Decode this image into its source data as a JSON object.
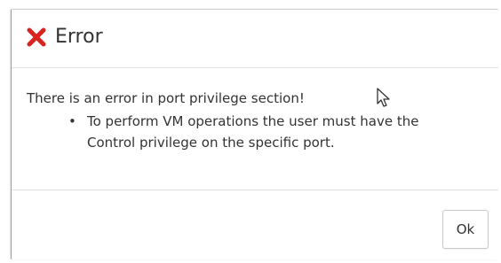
{
  "dialog": {
    "title": "Error",
    "icon": "close-x-icon",
    "accent_color": "#d9231f",
    "message": "There is an error in port privilege section!",
    "bullets": [
      {
        "line1": "To perform VM operations the user must have the",
        "line2": "Control privilege on the specific port."
      }
    ],
    "ok_label": "Ok"
  }
}
